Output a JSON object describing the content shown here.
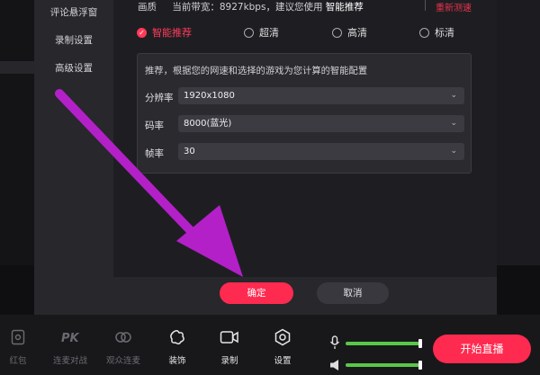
{
  "dialog": {
    "sidebar": [
      {
        "label": "评论悬浮窗"
      },
      {
        "label": "录制设置"
      },
      {
        "label": "高级设置"
      }
    ],
    "quality": {
      "label": "画质",
      "bandwidth": "当前带宽：8927kbps，建议您使用",
      "recommended": "智能推荐",
      "retest": "重新测速"
    },
    "options": [
      "智能推荐",
      "超清",
      "高清",
      "标清"
    ],
    "selected_option": "智能推荐",
    "panel": {
      "description": "推荐，根据您的网速和选择的游戏为您计算的智能配置",
      "fields": [
        {
          "label": "分辨率",
          "value": "1920x1080"
        },
        {
          "label": "码率",
          "value": "8000(蓝光)"
        },
        {
          "label": "帧率",
          "value": "30"
        }
      ]
    },
    "buttons": {
      "confirm": "确定",
      "cancel": "取消"
    }
  },
  "toolbar": {
    "items": [
      {
        "label": "红包",
        "icon": "red-packet-icon"
      },
      {
        "label": "连麦对战",
        "icon": "pk-icon"
      },
      {
        "label": "观众连麦",
        "icon": "link-icon"
      },
      {
        "label": "装饰",
        "icon": "sticker-icon"
      },
      {
        "label": "录制",
        "icon": "record-icon"
      },
      {
        "label": "设置",
        "icon": "settings-icon"
      }
    ],
    "start_live": "开始直播",
    "mic_level": 1.0,
    "speaker_level": 1.0
  },
  "colors": {
    "accent": "#ff2a4f",
    "volume": "#59c84a",
    "arrow": "#b320c8"
  }
}
